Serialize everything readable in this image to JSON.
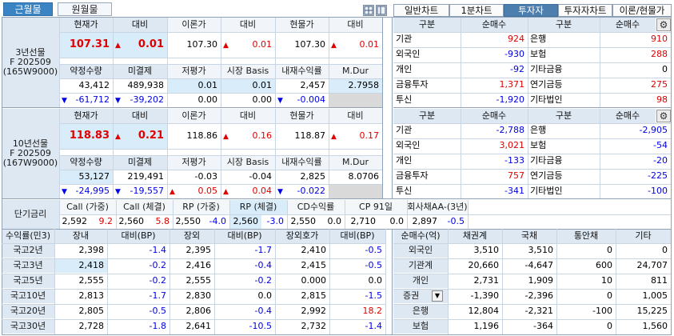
{
  "tabs": {
    "near_month": "근월물",
    "far_month": "원월물"
  },
  "right_tabs": [
    "일반차트",
    "1분차트",
    "투자자",
    "투자자차트",
    "이론/현물가"
  ],
  "fut3": {
    "label": [
      "3년선물",
      "F 202509",
      "(165W9000)"
    ],
    "h1": [
      "현재가",
      "대비",
      "이론가",
      "대비",
      "현물가",
      "대비"
    ],
    "v1": [
      "107.31",
      "0.01",
      "107.30",
      "0.01",
      "107.30",
      "0.01"
    ],
    "h2": [
      "약정수량",
      "미결제",
      "저평가",
      "시장 Basis",
      "내재수익률",
      "M.Dur"
    ],
    "v2": [
      "43,412",
      "489,938",
      "0.01",
      "0.01",
      "2,457",
      "2.7958"
    ],
    "v3": [
      "-61,712",
      "-39,202",
      "0.00",
      "0.00",
      "-0.004",
      ""
    ]
  },
  "fut10": {
    "label": [
      "10년선물",
      "F 202509",
      "(167W9000)"
    ],
    "h1": [
      "현재가",
      "대비",
      "이론가",
      "대비",
      "현물가",
      "대비"
    ],
    "v1": [
      "118.83",
      "0.21",
      "118.86",
      "0.16",
      "118.87",
      "0.17"
    ],
    "h2": [
      "약정수량",
      "미결제",
      "저평가",
      "시장 Basis",
      "내재수익률",
      "M.Dur"
    ],
    "v2": [
      "53,127",
      "219,491",
      "-0.03",
      "-0.04",
      "2,825",
      "8.0706"
    ],
    "v3": [
      "-24,995",
      "-19,557",
      "0.05",
      "0.04",
      "-0.022",
      ""
    ]
  },
  "inv3": {
    "headers": [
      "구분",
      "순매수",
      "구분",
      "순매수"
    ],
    "rows": [
      [
        "기관",
        "924",
        "은행",
        "910"
      ],
      [
        "외국인",
        "-930",
        "보험",
        "288"
      ],
      [
        "개인",
        "-92",
        "기타금융",
        "0"
      ],
      [
        "금융투자",
        "1,371",
        "연기금등",
        "275"
      ],
      [
        "투신",
        "-1,920",
        "기타법인",
        "98"
      ]
    ]
  },
  "inv10": {
    "headers": [
      "구분",
      "순매수",
      "구분",
      "순매수"
    ],
    "rows": [
      [
        "기관",
        "-2,788",
        "은행",
        "-2,905"
      ],
      [
        "외국인",
        "3,021",
        "보험",
        "-54"
      ],
      [
        "개인",
        "-133",
        "기타금융",
        "-20"
      ],
      [
        "금융투자",
        "757",
        "연기금등",
        "-225"
      ],
      [
        "투신",
        "-341",
        "기타법인",
        "-100"
      ]
    ]
  },
  "short_rate": {
    "title": "단기금리",
    "headers": [
      "Call (가중)",
      "Call (체결)",
      "RP (가중)",
      "RP (체결)",
      "CD수익률",
      "CP 91일",
      "회사채AA-(3년)"
    ],
    "values": [
      [
        "2,592",
        "9.2"
      ],
      [
        "2,560",
        "5.8"
      ],
      [
        "2,550",
        "-4.0"
      ],
      [
        "2,560",
        "-3.0"
      ],
      [
        "2,550",
        "0.0"
      ],
      [
        "2,710",
        "0.0"
      ],
      [
        "2,897",
        "-0.5"
      ]
    ]
  },
  "bond_yield": {
    "headers": [
      "수익률(민3)",
      "장내",
      "대비(BP)",
      "장외",
      "대비(BP)",
      "장외호가",
      "대비(BP)"
    ],
    "rows": [
      [
        "국고2년",
        "2,398",
        "-1.4",
        "2,395",
        "-1.7",
        "2,410",
        "-0.5"
      ],
      [
        "국고3년",
        "2,418",
        "-0.2",
        "2,416",
        "-0.4",
        "2,415",
        "-0.5"
      ],
      [
        "국고5년",
        "2,555",
        "-0.2",
        "2,555",
        "-0.2",
        "0.000",
        "0.0"
      ],
      [
        "국고10년",
        "2,813",
        "-1.7",
        "2,830",
        "0.0",
        "2,815",
        "-1.5"
      ],
      [
        "국고20년",
        "2,805",
        "-0.5",
        "2,806",
        "-0.4",
        "2,992",
        "18.2"
      ],
      [
        "국고30년",
        "2,728",
        "-1.8",
        "2,641",
        "-10.5",
        "2,732",
        "-1.4"
      ]
    ]
  },
  "bond_net": {
    "headers": [
      "순매수(억)",
      "채권계",
      "국채",
      "통안채",
      "기타"
    ],
    "rows": [
      [
        "외국인",
        "3,510",
        "3,510",
        "0",
        "0"
      ],
      [
        "기관계",
        "20,660",
        "-4,647",
        "600",
        "24,707"
      ],
      [
        "개인",
        "2,731",
        "1,909",
        "10",
        "811"
      ],
      [
        "증권",
        "-1,390",
        "-2,396",
        "0",
        "1,005"
      ],
      [
        "은행",
        "12,804",
        "-2,321",
        "-100",
        "15,225"
      ],
      [
        "보험",
        "1,196",
        "-364",
        "0",
        "1,560"
      ]
    ]
  },
  "colors": {
    "up": "#e00000",
    "down": "#0000e6",
    "header": "#dde8f3",
    "highlight": "#d8ecfa",
    "tab_active": "#3b84c4"
  }
}
